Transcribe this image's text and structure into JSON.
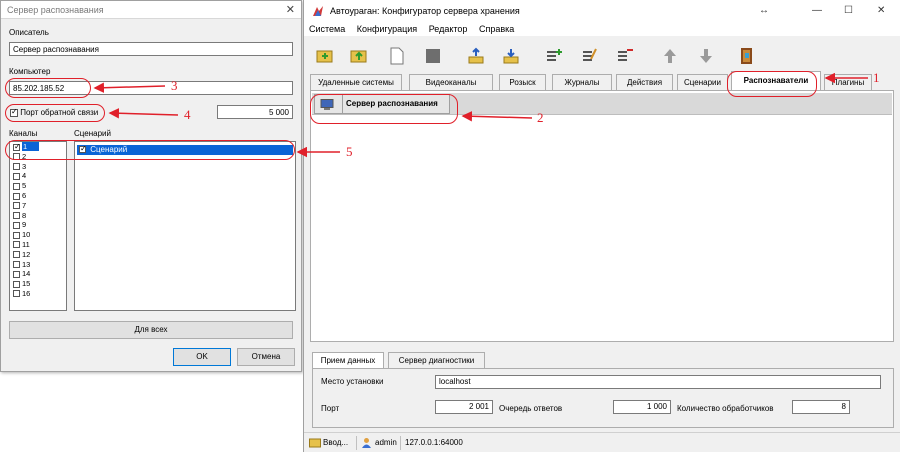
{
  "dialog": {
    "title": "Сервер распознавания",
    "close_glyph": "✕",
    "descriptor_label": "Описатель",
    "descriptor_value": "Сервер распознавания",
    "computer_label": "Компьютер",
    "computer_value": "85.202.185.52",
    "callback_port_label": "Порт обратной связи",
    "callback_port_checked": true,
    "callback_port_value": "5 000",
    "channels_label": "Каналы",
    "scenario_label": "Сценарий",
    "channels": [
      "1",
      "2",
      "3",
      "4",
      "5",
      "6",
      "7",
      "8",
      "9",
      "10",
      "11",
      "12",
      "13",
      "14",
      "15",
      "16"
    ],
    "selected_channel": "1",
    "scenarios": [
      {
        "label": "Сценарий",
        "checked": true
      }
    ],
    "for_all_button": "Для всех",
    "ok_button": "OK",
    "cancel_button": "Отмена"
  },
  "main": {
    "title": "Автоураган: Конфигуратор сервера хранения",
    "window_controls": {
      "extra": "↔",
      "minimize": "—",
      "maximize": "☐",
      "close": "✕"
    },
    "menu": [
      "Система",
      "Конфигурация",
      "Редактор",
      "Справка"
    ],
    "toolbar_icons": [
      "open-folder-icon",
      "folder-up-icon",
      "new-document-icon",
      "dark-square-icon",
      "upload-icon",
      "download-icon",
      "list-add-icon",
      "list-edit-icon",
      "list-remove-icon",
      "arrow-up-icon",
      "arrow-down-icon",
      "exit-door-icon"
    ],
    "tabs": [
      "Удаленные системы",
      "Видеоканалы",
      "Розыск",
      "Журналы",
      "Действия",
      "Сценарии",
      "Распознаватели",
      "Плагины"
    ],
    "active_tab": "Распознаватели",
    "recognizer_name": "Сервер распознавания",
    "subtabs": [
      "Прием данных",
      "Сервер диагностики"
    ],
    "active_subtab": "Прием данных",
    "install_location_label": "Место установки",
    "install_location_value": "localhost",
    "port_label": "Порт",
    "port_value": "2 001",
    "reply_queue_label": "Очередь ответов",
    "reply_queue_value": "1 000",
    "handlers_label": "Количество обработчиков",
    "handlers_value": "8",
    "status": {
      "input": "Ввод...",
      "user": "admin",
      "address": "127.0.0.1:64000"
    }
  },
  "annotations": [
    "1",
    "2",
    "3",
    "4",
    "5"
  ],
  "colors": {
    "annotation": "#e0202a",
    "selection": "#0a64d6",
    "header_band": "#d9d9d9"
  }
}
